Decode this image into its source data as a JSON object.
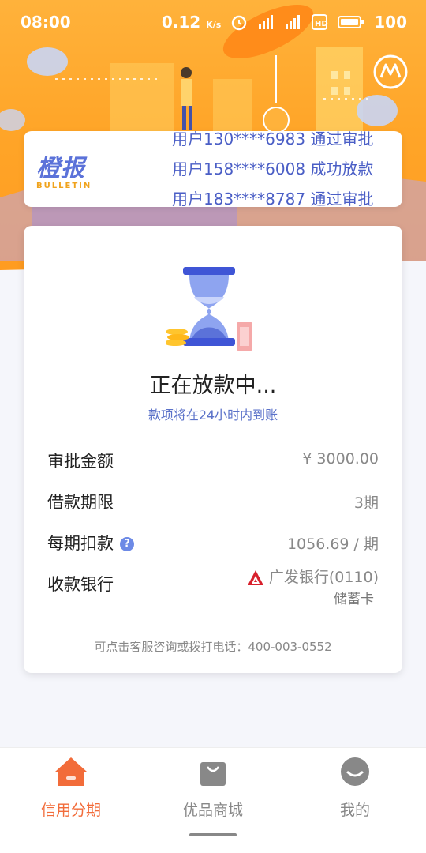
{
  "status_bar": {
    "time": "08:00",
    "network_speed": "0.12",
    "network_unit": "K/s",
    "battery": "100"
  },
  "bulletin": {
    "brand_title": "橙报",
    "brand_sub": "BULLETIN",
    "lines": [
      "用户130****6983 通过审批",
      "用户158****6008 成功放款",
      "用户183****8787 通过审批"
    ]
  },
  "loan_status": {
    "title": "正在放款中...",
    "subtitle": "款项将在24小时内到账"
  },
  "details": {
    "amount_label": "审批金额",
    "amount_value": "¥ 3000.00",
    "term_label": "借款期限",
    "term_value": "3期",
    "installment_label": "每期扣款",
    "installment_value": "1056.69 / 期",
    "bank_label": "收款银行",
    "bank_value": "广发银行(0110)",
    "bank_card_type": "储蓄卡"
  },
  "hotline": "可点击客服咨询或拨打电话：400-003-0552",
  "nav": {
    "items": [
      {
        "label": "信用分期",
        "icon": "home-icon"
      },
      {
        "label": "优品商城",
        "icon": "shopping-bag-icon"
      },
      {
        "label": "我的",
        "icon": "profile-icon"
      }
    ]
  },
  "colors": {
    "hero": "#ffa528",
    "accent_blue": "#5b72d9",
    "active_nav": "#f26c3a"
  }
}
